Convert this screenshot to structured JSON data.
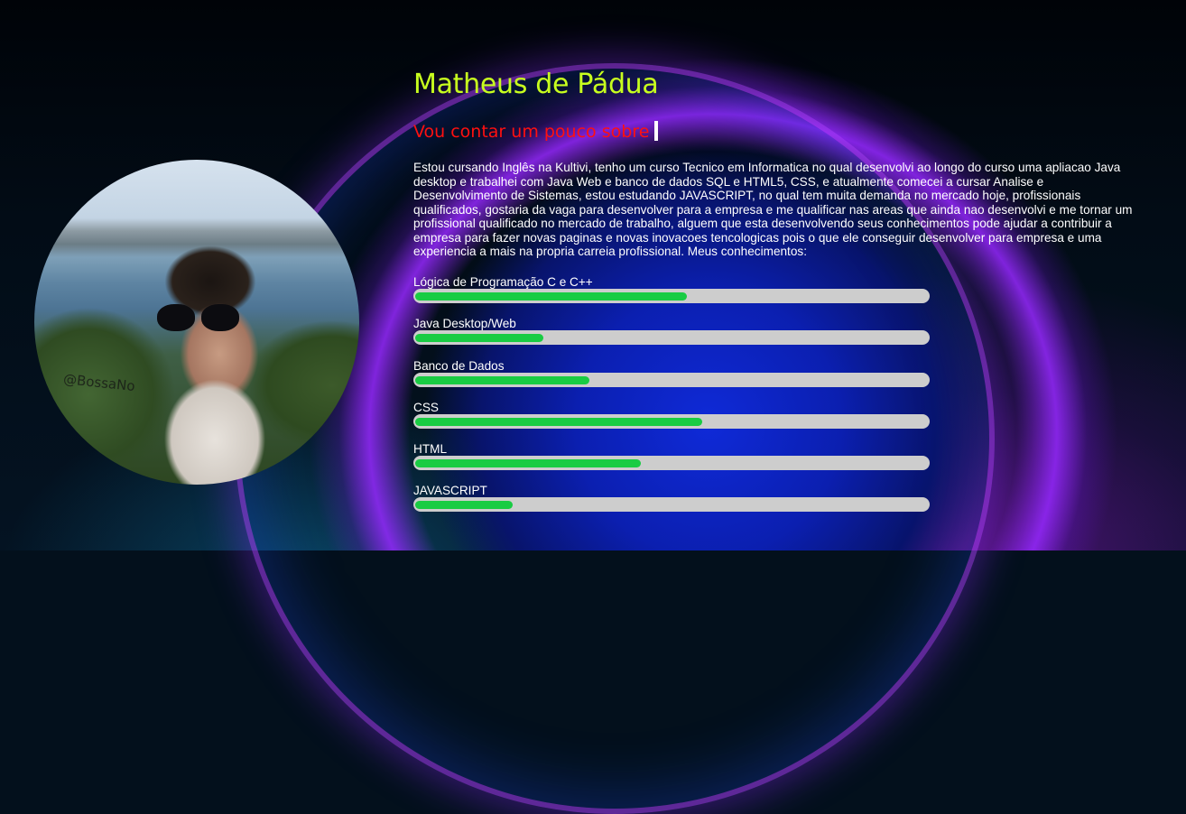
{
  "profile": {
    "name": "Matheus de Pádua",
    "subtitle": "Vou contar um pouco sobre",
    "photo_watermark": "@BossaNo",
    "about": "Estou cursando Inglês na Kultivi, tenho um curso Tecnico em Informatica no qual desenvolvi ao longo do curso uma apliacao Java desktop e trabalhei com Java Web e banco de dados SQL e HTML5, CSS, e atualmente comecei a cursar Analise e Desenvolvimento de Sistemas, estou estudando JAVASCRIPT, no qual tem muita demanda no mercado hoje, profissionais qualificados, gostaria da vaga para desenvolver para a empresa e me qualificar nas areas que ainda nao desenvolvi e me tornar um profissional qualificado no mercado de trabalho, alguem que esta desenvolvendo seus conhecimentos pode ajudar a contribuir a empresa para fazer novas paginas e novas inovacoes tencologicas pois o que ele conseguir desenvolver para empresa e uma experiencia a mais na propria carreia profissional. Meus conhecimentos:"
  },
  "skills": [
    {
      "label": "Lógica de Programação C e C++",
      "level": 0.53
    },
    {
      "label": "Java Desktop/Web",
      "level": 0.25
    },
    {
      "label": "Banco de Dados",
      "level": 0.34
    },
    {
      "label": "CSS",
      "level": 0.56
    },
    {
      "label": "HTML",
      "level": 0.44
    },
    {
      "label": "JAVASCRIPT",
      "level": 0.19
    }
  ],
  "colors": {
    "name": "#c8ff1e",
    "subtitle": "#ff1010",
    "skill_fill": "#19cc43",
    "skill_track": "#cdcdcd"
  }
}
